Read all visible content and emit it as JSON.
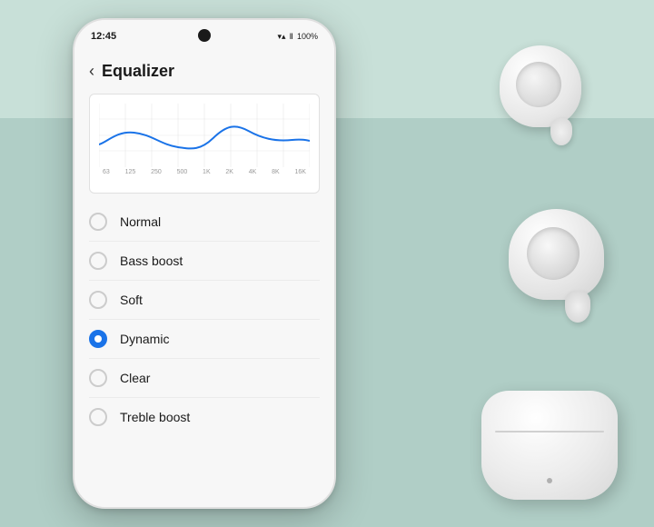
{
  "background": {
    "top_color": "#c8e0d8",
    "bottom_color": "#b0cec6"
  },
  "phone": {
    "status_bar": {
      "time": "12:45",
      "signal": "▲▼",
      "wifi": "WiFi",
      "battery": "100%"
    },
    "header": {
      "back_label": "‹",
      "title": "Equalizer"
    },
    "chart": {
      "freq_labels": [
        "63",
        "125",
        "250",
        "500",
        "1K",
        "2K",
        "4K",
        "8K",
        "16K"
      ]
    },
    "options": [
      {
        "id": "normal",
        "label": "Normal",
        "selected": false
      },
      {
        "id": "bass-boost",
        "label": "Bass boost",
        "selected": false
      },
      {
        "id": "soft",
        "label": "Soft",
        "selected": false
      },
      {
        "id": "dynamic",
        "label": "Dynamic",
        "selected": true
      },
      {
        "id": "clear",
        "label": "Clear",
        "selected": false
      },
      {
        "id": "treble-boost",
        "label": "Treble boost",
        "selected": false
      }
    ]
  }
}
